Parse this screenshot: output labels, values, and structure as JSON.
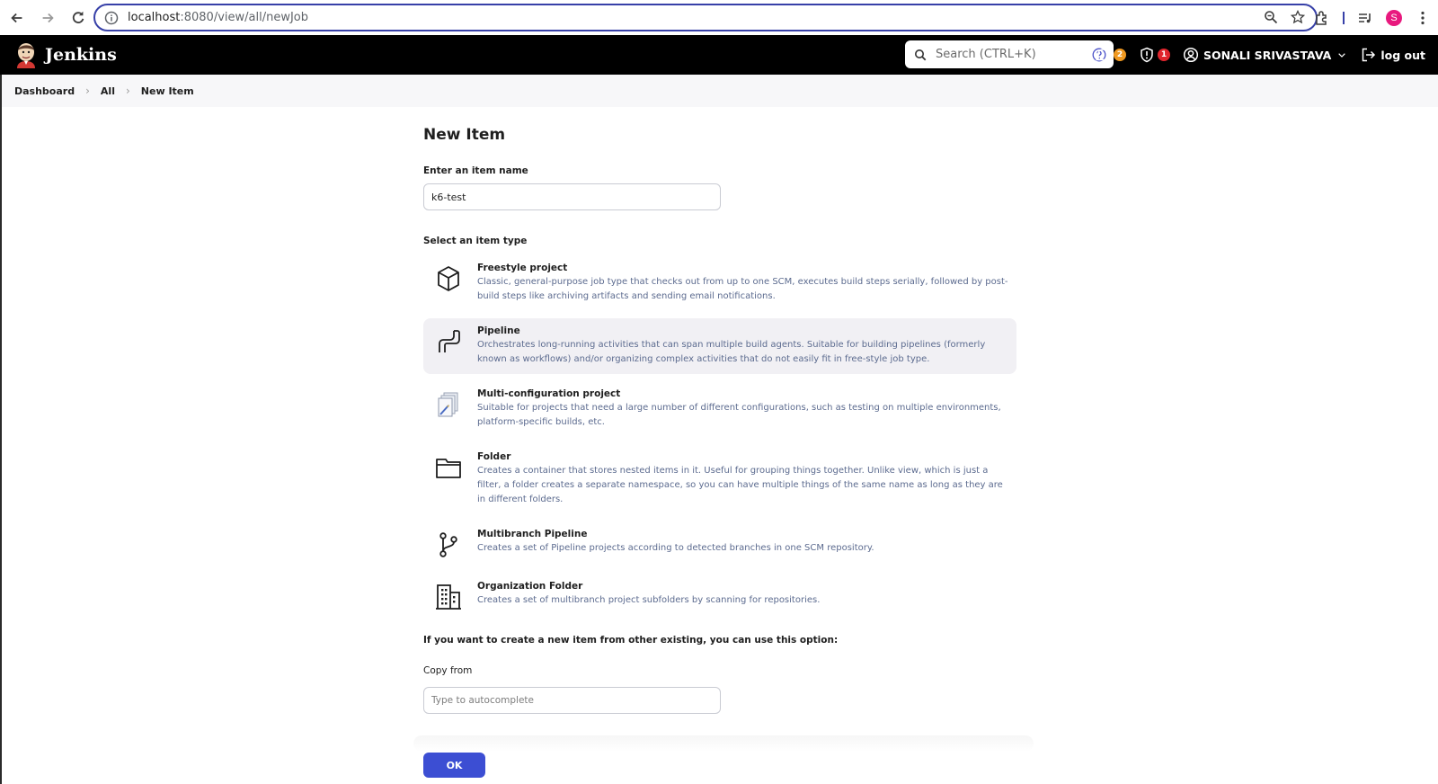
{
  "browser": {
    "url_host": "localhost",
    "url_rest": ":8080/view/all/newJob",
    "profile_initial": "S"
  },
  "header": {
    "brand": "Jenkins",
    "search_placeholder": "Search (CTRL+K)",
    "notifications_count": "2",
    "security_count": "1",
    "user_name": "SONALI SRIVASTAVA",
    "logout_label": "log out"
  },
  "breadcrumb": {
    "items": [
      "Dashboard",
      "All",
      "New Item"
    ]
  },
  "main": {
    "title": "New Item",
    "name_label": "Enter an item name",
    "name_value": "k6-test",
    "type_label": "Select an item type",
    "types": [
      {
        "name": "Freestyle project",
        "desc": "Classic, general-purpose job type that checks out from up to one SCM, executes build steps serially, followed by post-build steps like archiving artifacts and sending email notifications.",
        "icon": "box-icon"
      },
      {
        "name": "Pipeline",
        "desc": "Orchestrates long-running activities that can span multiple build agents. Suitable for building pipelines (formerly known as workflows) and/or organizing complex activities that do not easily fit in free-style job type.",
        "icon": "pipeline-icon"
      },
      {
        "name": "Multi-configuration project",
        "desc": "Suitable for projects that need a large number of different configurations, such as testing on multiple environments, platform-specific builds, etc.",
        "icon": "multi-config-icon"
      },
      {
        "name": "Folder",
        "desc": "Creates a container that stores nested items in it. Useful for grouping things together. Unlike view, which is just a filter, a folder creates a separate namespace, so you can have multiple things of the same name as long as they are in different folders.",
        "icon": "folder-icon"
      },
      {
        "name": "Multibranch Pipeline",
        "desc": "Creates a set of Pipeline projects according to detected branches in one SCM repository.",
        "icon": "branch-icon"
      },
      {
        "name": "Organization Folder",
        "desc": "Creates a set of multibranch project subfolders by scanning for repositories.",
        "icon": "building-icon"
      }
    ],
    "copy_hint": "If you want to create a new item from other existing, you can use this option:",
    "copy_label": "Copy from",
    "copy_placeholder": "Type to autocomplete",
    "ok_label": "OK"
  }
}
